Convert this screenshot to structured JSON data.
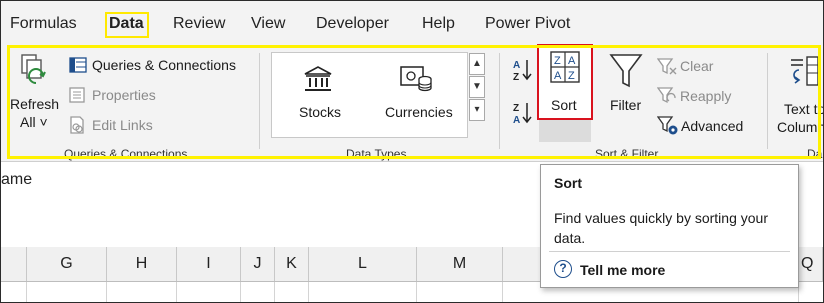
{
  "tabs": [
    "Formulas",
    "Data",
    "Review",
    "View",
    "Developer",
    "Help",
    "Power Pivot"
  ],
  "active_tab": "Data",
  "queries_group": {
    "refresh_label_1": "Refresh",
    "refresh_label_2": "All ˅",
    "queries_connections": "Queries & Connections",
    "properties": "Properties",
    "edit_links": "Edit Links",
    "group_label": "Queries & Connections"
  },
  "data_types_group": {
    "stocks": "Stocks",
    "currencies": "Currencies",
    "group_label": "Data Types"
  },
  "sort_filter_group": {
    "sort": "Sort",
    "filter": "Filter",
    "clear": "Clear",
    "reapply": "Reapply",
    "advanced": "Advanced",
    "group_label": "Sort & Filter"
  },
  "data_tools_group": {
    "text_to_1": "Text to",
    "text_to_2": "Column",
    "group_label_partial": "Da"
  },
  "name_box_text": "ame",
  "columns": [
    "G",
    "H",
    "I",
    "J",
    "K",
    "L",
    "M",
    "Q"
  ],
  "tooltip": {
    "title": "Sort",
    "description": "Find values quickly by sorting your data.",
    "help_link": "Tell me more",
    "help_icon": "question-circle-icon"
  },
  "colors": {
    "highlight_yellow": "#fff200",
    "sort_red": "#d9121e",
    "ribbon_bg": "#f3f3f3",
    "icon_blue": "#1e4e8c"
  }
}
